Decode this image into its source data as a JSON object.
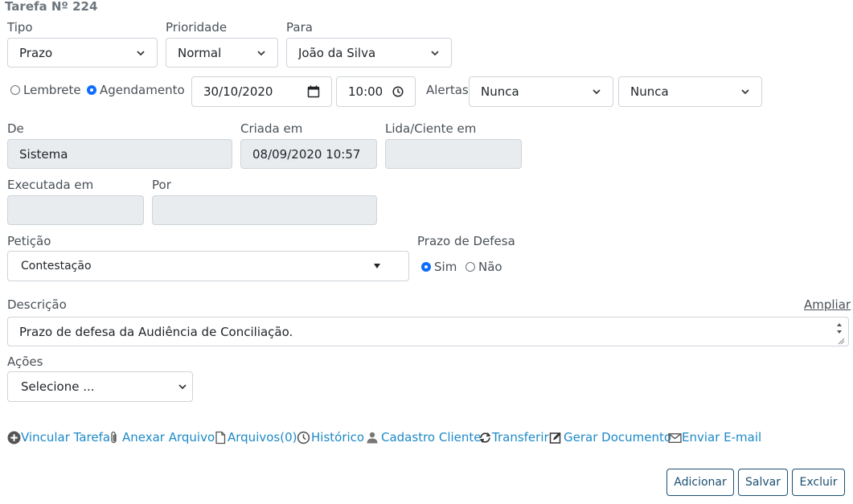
{
  "title": "Tarefa Nº 224",
  "labels": {
    "tipo": "Tipo",
    "prioridade": "Prioridade",
    "para": "Para",
    "alertas": "Alertas",
    "de": "De",
    "criada_em": "Criada em",
    "lida_em": "Lida/Ciente em",
    "executada_em": "Executada em",
    "por": "Por",
    "peticao": "Petição",
    "prazo_defesa": "Prazo de Defesa",
    "descricao": "Descrição",
    "ampliar": "Ampliar",
    "acoes": "Ações"
  },
  "fields": {
    "tipo": "Prazo",
    "prioridade": "Normal",
    "para": "João da Silva",
    "date": "30/10/2020",
    "time": "10:00",
    "alerta1": "Nunca",
    "alerta2": "Nunca",
    "de": "Sistema",
    "criada_em": "08/09/2020 10:57",
    "lida_em": "",
    "executada_em": "",
    "por": "",
    "peticao": "Contestação",
    "descricao": "Prazo de defesa da Audiência de Conciliação.",
    "acoes": "Selecione ..."
  },
  "radios": {
    "lembrete": {
      "label": "Lembrete",
      "checked": false
    },
    "agendamento": {
      "label": "Agendamento",
      "checked": true
    },
    "sim": {
      "label": "Sim",
      "checked": true
    },
    "nao": {
      "label": "Não",
      "checked": false
    }
  },
  "links": {
    "vincular": "Vincular Tarefa",
    "anexar": "Anexar Arquivo",
    "arquivos": "Arquivos(0)",
    "historico": "Histórico",
    "cadastro": "Cadastro Cliente",
    "transferir": "Transferir",
    "gerar": "Gerar Documento",
    "email": "Enviar E-mail"
  },
  "buttons": {
    "adicionar": "Adicionar",
    "salvar": "Salvar",
    "excluir": "Excluir"
  },
  "colors": {
    "link": "#1c89c8",
    "button_border": "#1b4f72",
    "disabled_bg": "#e9ecef"
  }
}
